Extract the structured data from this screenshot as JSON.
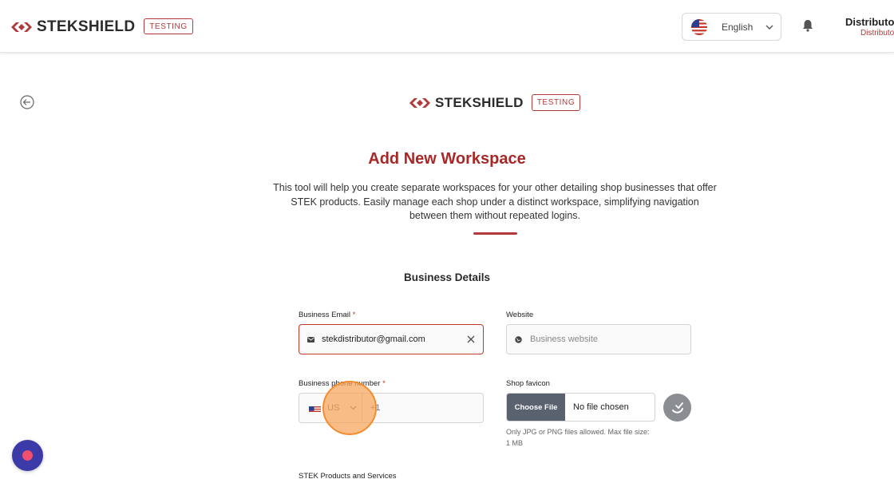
{
  "header": {
    "brand": "STEKSHIELD",
    "env_badge": "TESTING",
    "language": {
      "label": "English",
      "flag_icon": "us-flag-icon"
    },
    "notification_icon": "bell-icon",
    "user": {
      "name": "Distributor",
      "role": "Distributor"
    }
  },
  "page": {
    "back_icon": "arrow-left-circle-icon",
    "brand": "STEKSHIELD",
    "env_badge": "TESTING",
    "title": "Add New Workspace",
    "description": "This tool will help you create separate workspaces for your other detailing shop businesses that offer STEK products. Easily manage each shop under a distinct workspace, simplifying navigation between them without repeated logins.",
    "section_title": "Business Details"
  },
  "form": {
    "email": {
      "label": "Business Email",
      "required_mark": "*",
      "value": "stekdistributor@gmail.com",
      "icon": "envelope-icon"
    },
    "website": {
      "label": "Website",
      "placeholder": "Business website",
      "icon": "globe-icon"
    },
    "phone": {
      "label": "Business phone number",
      "required_mark": "*",
      "country": "US",
      "dial_code": "+1"
    },
    "favicon": {
      "label": "Shop favicon",
      "choose_label": "Choose File",
      "file_status": "No file chosen",
      "hint": "Only JPG or PNG files allowed. Max file size: 1 MB"
    },
    "products": {
      "label": "STEK Products and Services"
    }
  },
  "colors": {
    "brand_red": "#a82828",
    "chat_bg": "#3b3aa8",
    "file_button": "#5a6270"
  }
}
